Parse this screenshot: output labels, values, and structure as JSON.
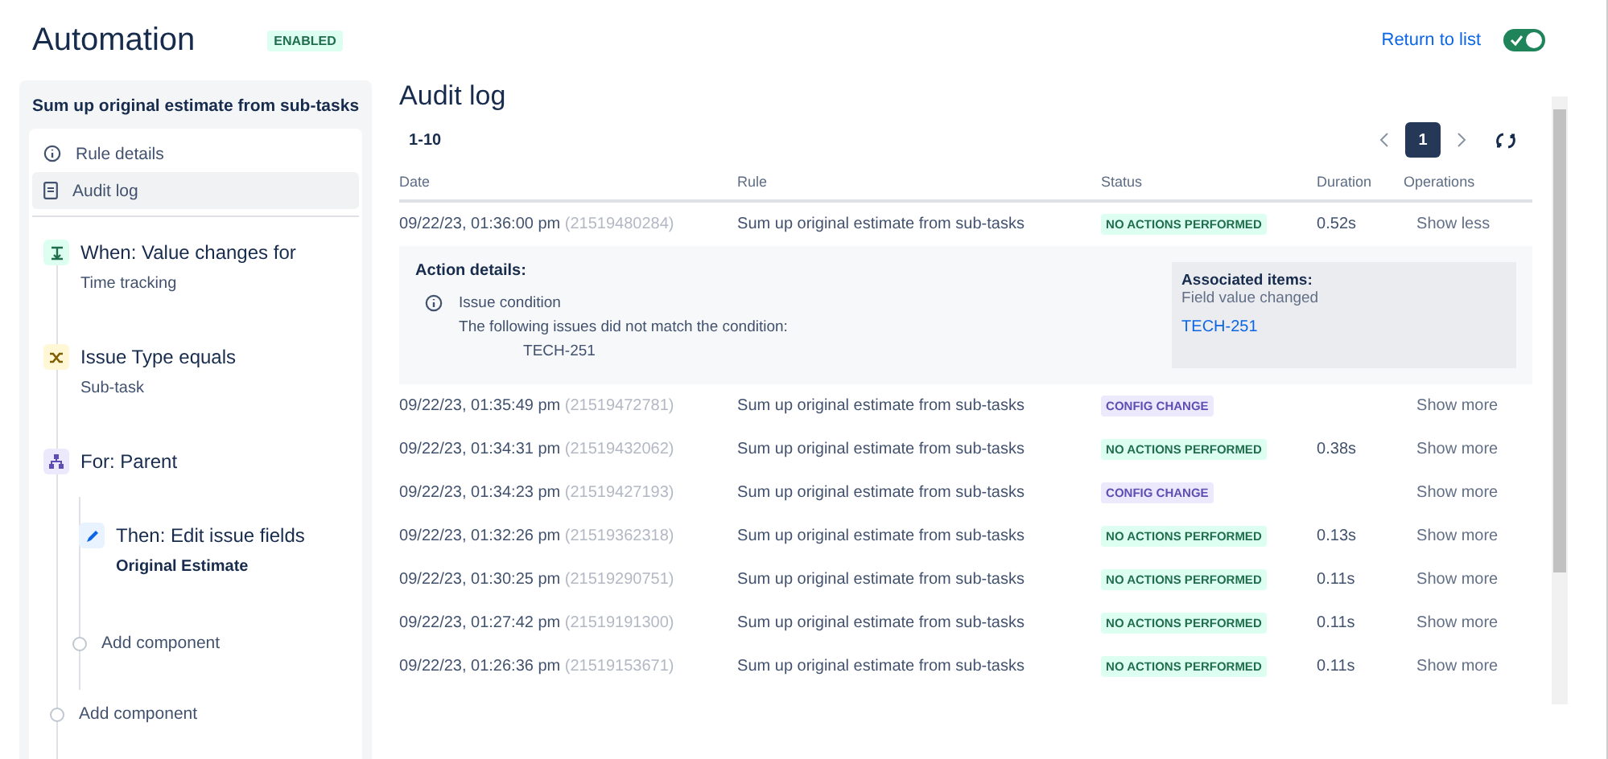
{
  "header": {
    "title": "Automation",
    "status_badge": "ENABLED",
    "return_link": "Return to list",
    "toggle": {
      "on": true
    }
  },
  "sidebar": {
    "rule_name": "Sum up original estimate from sub-tasks",
    "nav": [
      {
        "label": "Rule details",
        "selected": false
      },
      {
        "label": "Audit log",
        "selected": true
      }
    ],
    "steps": [
      {
        "kind": "trigger",
        "title": "When: Value changes for",
        "detail": "Time tracking"
      },
      {
        "kind": "condition",
        "title": "Issue Type equals",
        "detail": "Sub-task"
      },
      {
        "kind": "branch",
        "title": "For: Parent",
        "children": [
          {
            "kind": "action",
            "title": "Then: Edit issue fields",
            "detail": "Original Estimate"
          },
          {
            "kind": "add",
            "title": "Add component"
          }
        ]
      },
      {
        "kind": "add",
        "title": "Add component"
      }
    ]
  },
  "audit_log": {
    "title": "Audit log",
    "range": "1-10",
    "pages": [
      {
        "label": "1",
        "selected": true
      }
    ],
    "columns": [
      "Date",
      "Rule",
      "Status",
      "Duration",
      "Operations"
    ],
    "rows": [
      {
        "date": "09/22/23, 01:36:00 pm",
        "id": "(21519480284)",
        "rule": "Sum up original estimate from sub-tasks",
        "status": {
          "kind": "none",
          "label": "NO ACTIONS PERFORMED"
        },
        "duration": "0.52s",
        "operation": "Show less",
        "details": {
          "heading": "Action details:",
          "item_title": "Issue condition",
          "item_text": "The following issues did not match the condition:",
          "item_issue": "TECH-251",
          "assoc_heading": "Associated items:",
          "assoc_text": "Field value changed",
          "assoc_link": "TECH-251"
        }
      },
      {
        "date": "09/22/23, 01:35:49 pm",
        "id": "(21519472781)",
        "rule": "Sum up original estimate from sub-tasks",
        "status": {
          "kind": "config",
          "label": "CONFIG CHANGE"
        },
        "operation": "Show more"
      },
      {
        "date": "09/22/23, 01:34:31 pm",
        "id": "(21519432062)",
        "rule": "Sum up original estimate from sub-tasks",
        "status": {
          "kind": "none",
          "label": "NO ACTIONS PERFORMED"
        },
        "duration": "0.38s",
        "operation": "Show more"
      },
      {
        "date": "09/22/23, 01:34:23 pm",
        "id": "(21519427193)",
        "rule": "Sum up original estimate from sub-tasks",
        "status": {
          "kind": "config",
          "label": "CONFIG CHANGE"
        },
        "operation": "Show more"
      },
      {
        "date": "09/22/23, 01:32:26 pm",
        "id": "(21519362318)",
        "rule": "Sum up original estimate from sub-tasks",
        "status": {
          "kind": "none",
          "label": "NO ACTIONS PERFORMED"
        },
        "duration": "0.13s",
        "operation": "Show more"
      },
      {
        "date": "09/22/23, 01:30:25 pm",
        "id": "(21519290751)",
        "rule": "Sum up original estimate from sub-tasks",
        "status": {
          "kind": "none",
          "label": "NO ACTIONS PERFORMED"
        },
        "duration": "0.11s",
        "operation": "Show more"
      },
      {
        "date": "09/22/23, 01:27:42 pm",
        "id": "(21519191300)",
        "rule": "Sum up original estimate from sub-tasks",
        "status": {
          "kind": "none",
          "label": "NO ACTIONS PERFORMED"
        },
        "duration": "0.11s",
        "operation": "Show more"
      },
      {
        "date": "09/22/23, 01:26:36 pm",
        "id": "(21519153671)",
        "rule": "Sum up original estimate from sub-tasks",
        "status": {
          "kind": "none",
          "label": "NO ACTIONS PERFORMED"
        },
        "duration": "0.11s",
        "operation": "Show more"
      }
    ]
  }
}
